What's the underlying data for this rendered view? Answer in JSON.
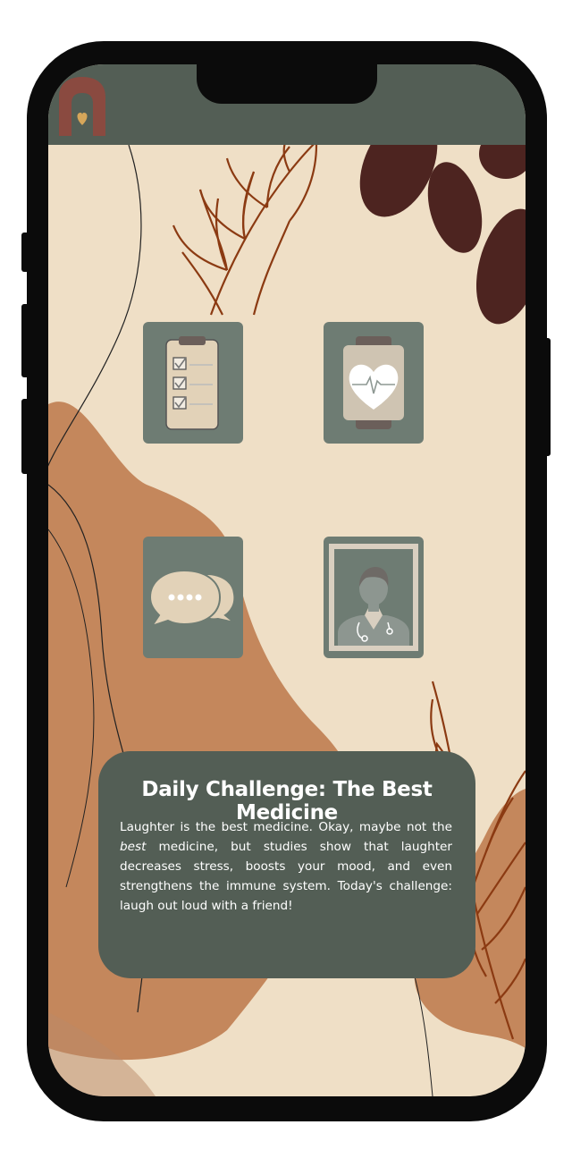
{
  "app": {
    "logo_icon": "heart-arch-logo-icon"
  },
  "tiles": [
    {
      "name": "checklist",
      "icon": "clipboard-checklist-icon"
    },
    {
      "name": "health",
      "icon": "heart-rate-icon"
    },
    {
      "name": "chat",
      "icon": "chat-bubbles-icon"
    },
    {
      "name": "doctor",
      "icon": "doctor-portrait-icon"
    }
  ],
  "daily_challenge": {
    "title": "Daily Challenge: The Best Medicine",
    "body_part1": "Laughter is the best medicine. Okay, maybe not the ",
    "body_emphasis": "best",
    "body_part2": " medicine, but studies show that laughter decreases stress, boosts your mood, and even strengthens the immune system. Today's challenge: laugh out loud with a friend!"
  },
  "colors": {
    "header": "#535e55",
    "background": "#efdfc6",
    "accent_terracotta": "#c4875c",
    "accent_brown": "#4d2420",
    "tile": "#6e7c73",
    "logo": "#8a4a40"
  }
}
